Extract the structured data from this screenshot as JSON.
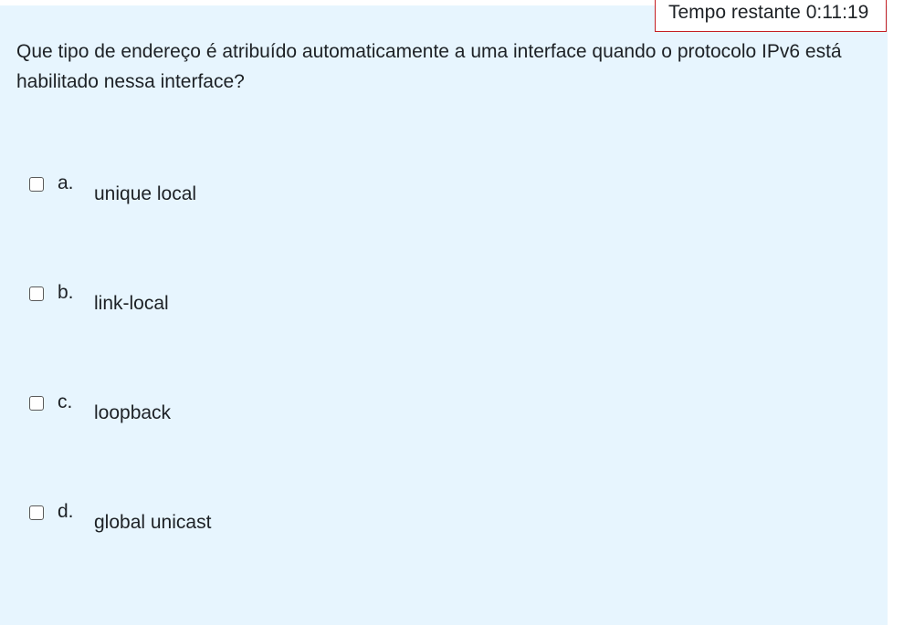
{
  "timer": {
    "label": "Tempo restante",
    "value": "0:11:19"
  },
  "question": {
    "text": "Que tipo de endereço é atribuído automaticamente a uma interface quando o protocolo IPv6 está habilitado nessa interface?"
  },
  "answers": [
    {
      "letter": "a.",
      "label": "unique local",
      "checked": false
    },
    {
      "letter": "b.",
      "label": "link-local",
      "checked": false
    },
    {
      "letter": "c.",
      "label": "loopback",
      "checked": false
    },
    {
      "letter": "d.",
      "label": "global unicast",
      "checked": false
    }
  ]
}
